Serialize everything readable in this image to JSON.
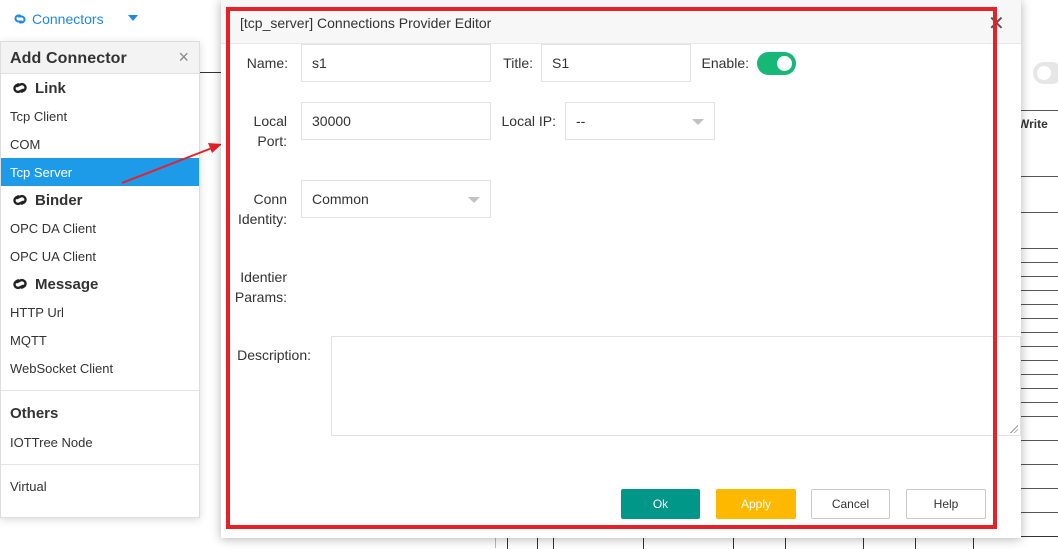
{
  "topbar": {
    "connectors_label": "Connectors"
  },
  "background": {
    "write_label": "Write"
  },
  "menu": {
    "title": "Add Connector",
    "close_glyph": "×",
    "categories": [
      {
        "label": "Link",
        "items": [
          "Tcp Client",
          "COM",
          "Tcp Server"
        ]
      },
      {
        "label": "Binder",
        "items": [
          "OPC DA Client",
          "OPC UA Client"
        ]
      },
      {
        "label": "Message",
        "items": [
          "HTTP Url",
          "MQTT",
          "WebSocket Client"
        ]
      }
    ],
    "others_label": "Others",
    "others_items": [
      "IOTTree Node"
    ],
    "virtual_label": "Virtual",
    "selected_item": "Tcp Server"
  },
  "dialog": {
    "title": "[tcp_server] Connections Provider Editor",
    "close_glyph": "✕",
    "name_label": "Name:",
    "name_value": "s1",
    "title_label": "Title:",
    "title_value": "S1",
    "enable_label": "Enable:",
    "enable_on": true,
    "local_port_label_1": "Local",
    "local_port_label_2": "Port:",
    "local_port_value": "30000",
    "local_ip_label": "Local IP:",
    "local_ip_value": "--",
    "conn_identity_label_1": "Conn",
    "conn_identity_label_2": "Identity:",
    "conn_identity_value": "Common",
    "identier_params_label_1": "Identier",
    "identier_params_label_2": "Params:",
    "description_label": "Description:",
    "description_value": "",
    "buttons": {
      "ok": "Ok",
      "apply": "Apply",
      "cancel": "Cancel",
      "help": "Help"
    }
  },
  "colors": {
    "accent_blue": "#1e9be8",
    "ok_teal": "#009688",
    "apply_yellow": "#ffb800",
    "switch_green": "#16b777",
    "highlight_red": "#e8202a"
  }
}
